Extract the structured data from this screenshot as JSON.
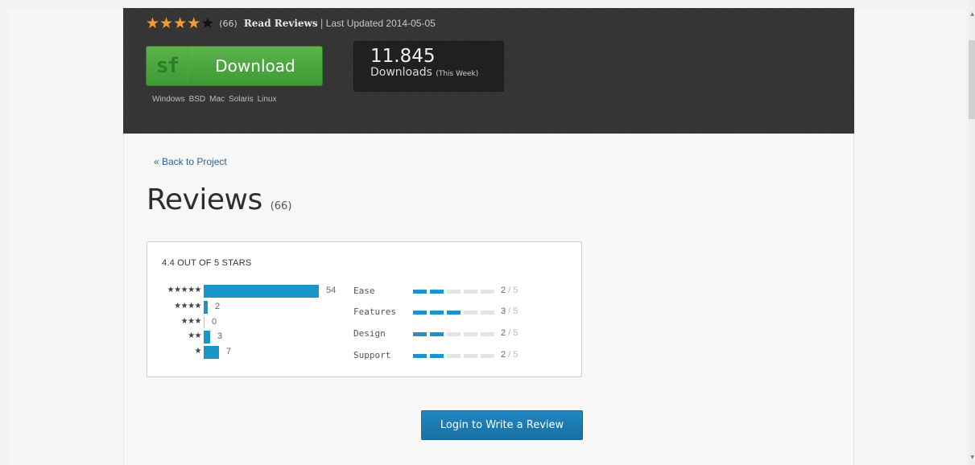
{
  "header": {
    "rating_stars": {
      "filled": 4,
      "total": 5
    },
    "rating_count": "(66)",
    "read_reviews": "Read Reviews",
    "separator": "|",
    "last_updated": "Last Updated 2014-05-05",
    "download_button": {
      "logo": "sf",
      "label": "Download"
    },
    "platforms": [
      "Windows",
      "BSD",
      "Mac",
      "Solaris",
      "Linux"
    ],
    "downloads": {
      "count": "11.845",
      "label": "Downloads",
      "sublabel": "(This Week)"
    }
  },
  "content": {
    "back_link": "« Back to Project",
    "title": "Reviews",
    "title_count": "(66)",
    "summary": {
      "heading": "4.4 OUT OF 5 STARS",
      "distribution": [
        {
          "stars": "★★★★★",
          "count": "54",
          "value": 54
        },
        {
          "stars": "★★★★",
          "count": "2",
          "value": 2
        },
        {
          "stars": "★★★",
          "count": "0",
          "value": 0
        },
        {
          "stars": "★★",
          "count": "3",
          "value": 3
        },
        {
          "stars": "★",
          "count": "7",
          "value": 7
        }
      ],
      "categories": [
        {
          "label": "Ease",
          "score": "2",
          "max": "5"
        },
        {
          "label": "Features",
          "score": "3",
          "max": "5"
        },
        {
          "label": "Design",
          "score": "2",
          "max": "5"
        },
        {
          "label": "Support",
          "score": "2",
          "max": "5"
        }
      ]
    },
    "login_button": "Login to Write a Review"
  },
  "colors": {
    "accent": "#1a94c9",
    "download_green": "#4aa83f",
    "header_bg": "#343434"
  }
}
